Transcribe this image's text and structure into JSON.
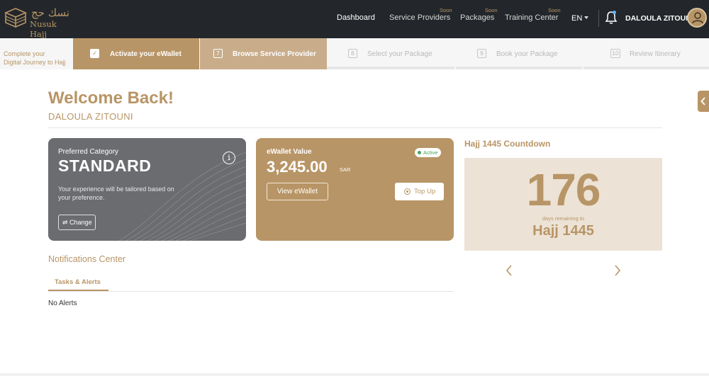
{
  "brand": {
    "name_en": "Nusuk Hajj",
    "name_ar": "نسك حج"
  },
  "nav": {
    "items": [
      {
        "label": "Dashboard",
        "soon": ""
      },
      {
        "label": "Service Providers",
        "soon": "Soon"
      },
      {
        "label": "Packages",
        "soon": "Soon"
      },
      {
        "label": "Training Center",
        "soon": "Soon"
      }
    ],
    "language": "EN",
    "user": "DALOULA ZITOUNI"
  },
  "steps": {
    "intro_line1": "Complete your",
    "intro_line2": "Digital Journey to Hajj",
    "items": [
      {
        "num": "✓",
        "label": "Activate your eWallet"
      },
      {
        "num": "7",
        "label": "Browse Service Provider"
      },
      {
        "num": "8",
        "label": "Select your Package"
      },
      {
        "num": "9",
        "label": "Book your Package"
      },
      {
        "num": "10",
        "label": "Review Itinerary"
      }
    ]
  },
  "main": {
    "welcome": "Welcome Back!",
    "user_name": "DALOULA ZITOUNI"
  },
  "category_card": {
    "label": "Preferred Category",
    "value": "STANDARD",
    "description": "Your experience will be tailored based on your preference.",
    "change_label": "⇌ Change",
    "info_glyph": "i"
  },
  "wallet_card": {
    "label": "eWallet Value",
    "value": "3,245.00",
    "currency": "SAR",
    "status": "Active",
    "view_label": "View eWallet",
    "topup_label": "Top Up"
  },
  "countdown": {
    "title": "Hajj 1445 Countdown",
    "days": "176",
    "subtitle": "days remaining to",
    "target": "Hajj 1445"
  },
  "notifications": {
    "title": "Notifications Center",
    "tab": "Tasks & Alerts",
    "empty": "No Alerts"
  },
  "colors": {
    "gold": "#b89566",
    "dark": "#23272b",
    "gray_card": "#6a6c6f",
    "beige": "#ece2d5",
    "active_green": "#49a55b"
  }
}
